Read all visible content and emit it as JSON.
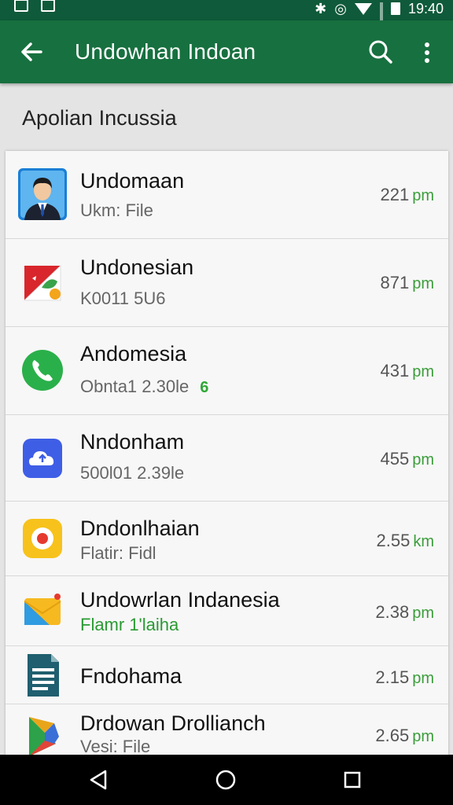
{
  "status_bar": {
    "time": "19:40",
    "icons": [
      "image-icon",
      "image-icon",
      "bluetooth-icon",
      "alarm-icon",
      "wifi-icon",
      "signal-icon",
      "battery-icon"
    ]
  },
  "app_bar": {
    "title": "Undowhan Indoan",
    "back_icon": "arrow-left-icon",
    "search_icon": "search-icon",
    "menu_icon": "more-vert-icon",
    "color": "#17703f"
  },
  "section": {
    "title": "Apolian Incussia"
  },
  "list": {
    "items": [
      {
        "title": "Undomaan",
        "subtitle": "Ukm: File",
        "time": "221",
        "unit": "pm",
        "icon": "contact-avatar-icon"
      },
      {
        "title": "Undonesian",
        "subtitle": "K0011 5U6",
        "time": "871",
        "unit": "pm",
        "icon": "flag-app-icon"
      },
      {
        "title": "Andomesia",
        "subtitle": "Obnta1 2.30le",
        "badge": "6",
        "time": "431",
        "unit": "pm",
        "icon": "phone-icon"
      },
      {
        "title": "Nndonham",
        "subtitle": "500l01 2.39le",
        "time": "455",
        "unit": "pm",
        "icon": "cloud-upload-icon"
      },
      {
        "title": "Dndonlhaian",
        "subtitle": "Flatir: Fidl",
        "time": "2.55",
        "unit": "km",
        "icon": "record-icon"
      },
      {
        "title": "Undowrlan  Indanesia",
        "subtitle": "Flamr 1'laiha",
        "subtitle_green": true,
        "time": "2.38",
        "unit": "pm",
        "icon": "mail-app-icon"
      },
      {
        "title": "Fndohama",
        "subtitle": "",
        "time": "2.15",
        "unit": "pm",
        "icon": "document-icon"
      },
      {
        "title": "Drdowan Drollianch",
        "subtitle": "Vesi: File",
        "time": "2.65",
        "unit": "pm",
        "icon": "play-store-icon"
      }
    ]
  },
  "nav_bar": {
    "buttons": [
      "back-triangle-icon",
      "home-circle-icon",
      "recents-square-icon"
    ]
  }
}
